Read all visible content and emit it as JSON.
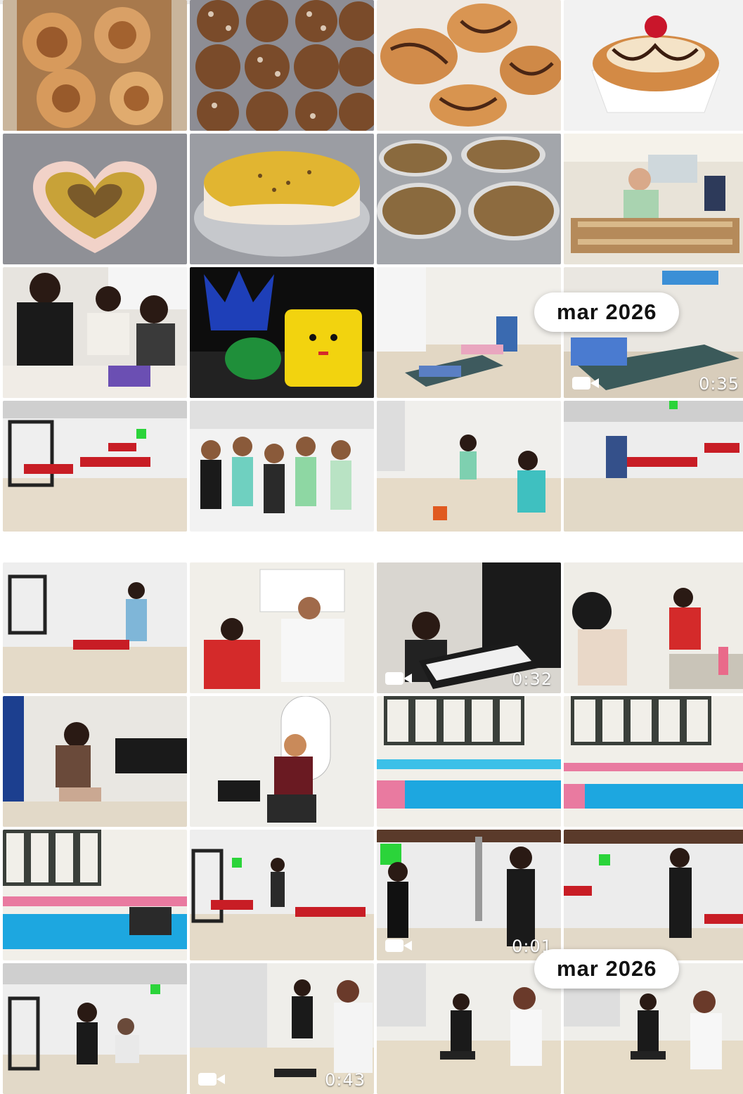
{
  "scrubber_labels": [
    "mar 2026",
    "mar 2026"
  ],
  "top_tiles": [
    {
      "kind": "photo",
      "subject": "cinnamon rolls in glass dish"
    },
    {
      "kind": "photo",
      "subject": "chocolate sprinkled pastries in tray"
    },
    {
      "kind": "photo",
      "subject": "chocolate drizzled buns on plate"
    },
    {
      "kind": "photo",
      "subject": "cupcake with cherry"
    },
    {
      "kind": "photo",
      "subject": "heart shaped cheesecake"
    },
    {
      "kind": "photo",
      "subject": "round cheesecake on platter"
    },
    {
      "kind": "photo",
      "subject": "four pies on counter"
    },
    {
      "kind": "photo",
      "subject": "man doing woodwork"
    },
    {
      "kind": "photo",
      "subject": "women crafting at table"
    },
    {
      "kind": "photo",
      "subject": "crochet tulip and yellow bag"
    },
    {
      "kind": "photo",
      "subject": "women exercising on mats"
    },
    {
      "kind": "video",
      "subject": "person exercising on mat",
      "duration": "0:35"
    },
    {
      "kind": "photo",
      "subject": "gym room with red machines"
    },
    {
      "kind": "photo",
      "subject": "group of women smiling"
    },
    {
      "kind": "photo",
      "subject": "women doing step class"
    },
    {
      "kind": "photo",
      "subject": "gym room with machines"
    }
  ],
  "bottom_tiles": [
    {
      "kind": "photo",
      "subject": "women in gym"
    },
    {
      "kind": "photo",
      "subject": "classroom with women writing"
    },
    {
      "kind": "video",
      "subject": "child playing keyboard",
      "duration": "0:32"
    },
    {
      "kind": "photo",
      "subject": "makeup class"
    },
    {
      "kind": "photo",
      "subject": "woman sitting on stool"
    },
    {
      "kind": "photo",
      "subject": "woman posing in salon chair"
    },
    {
      "kind": "photo",
      "subject": "classroom with blue tables"
    },
    {
      "kind": "photo",
      "subject": "classroom with blue tables"
    },
    {
      "kind": "photo",
      "subject": "classroom with students"
    },
    {
      "kind": "photo",
      "subject": "gym with red benches"
    },
    {
      "kind": "video",
      "subject": "people boxing in gym",
      "duration": "0:01"
    },
    {
      "kind": "photo",
      "subject": "people boxing in gym"
    },
    {
      "kind": "photo",
      "subject": "gym with woman exercising"
    },
    {
      "kind": "video",
      "subject": "step aerobics class",
      "duration": "0:43"
    },
    {
      "kind": "photo",
      "subject": "step aerobics class"
    },
    {
      "kind": "photo",
      "subject": "step aerobics class"
    }
  ],
  "colors": {
    "accent": "#ffffff",
    "band_ghost": "#f3e6f0"
  }
}
